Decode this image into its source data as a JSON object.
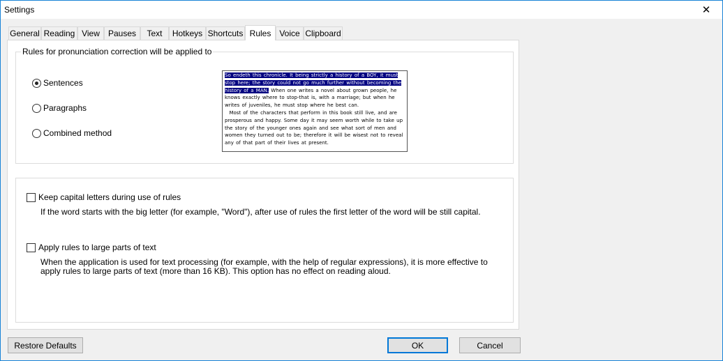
{
  "window": {
    "title": "Settings"
  },
  "tabs": [
    {
      "label": "General",
      "active": false
    },
    {
      "label": "Reading",
      "active": false
    },
    {
      "label": "View",
      "active": false
    },
    {
      "label": "Pauses",
      "active": false
    },
    {
      "label": "Text",
      "active": false
    },
    {
      "label": "Hotkeys",
      "active": false
    },
    {
      "label": "Shortcuts",
      "active": false
    },
    {
      "label": "Rules",
      "active": true
    },
    {
      "label": "Voice",
      "active": false
    },
    {
      "label": "Clipboard",
      "active": false
    }
  ],
  "rules_group": {
    "label": "Rules for pronunciation correction will be applied to",
    "options": [
      {
        "label": "Sentences",
        "checked": true
      },
      {
        "label": "Paragraphs",
        "checked": false
      },
      {
        "label": "Combined method",
        "checked": false
      }
    ],
    "preview": {
      "highlighted": "So endeth this chronicle. It being strictly a history of a BOY, it must stop here; the story could not go much further without becoming the history of a MAN.",
      "rest_1": " When one writes a novel about grown people, he knows exactly where to stop-that is, with a marriage; but when he writes of juveniles, he must stop where he best can.",
      "rest_2": "Most of the characters that perform in this book still live, and are prosperous and happy. Some day it may seem worth while to take up the story of the younger ones again and see what sort of men and women they turned out to be; therefore it will be wisest not to reveal any of that part of their lives at present."
    }
  },
  "options": {
    "keep_capital": {
      "label": "Keep capital letters during use of rules",
      "checked": false,
      "description": "If the word starts with the big letter (for example, \"Word\"), after use of rules the first letter of the word will be still capital."
    },
    "large_parts": {
      "label": "Apply rules to large parts of text",
      "checked": false,
      "description": "When the application is used for text processing (for example, with the help of regular expressions), it is more effective to apply rules to large parts of text (more than 16 KB). This option has no effect on reading aloud."
    }
  },
  "buttons": {
    "restore": "Restore Defaults",
    "ok": "OK",
    "cancel": "Cancel"
  }
}
